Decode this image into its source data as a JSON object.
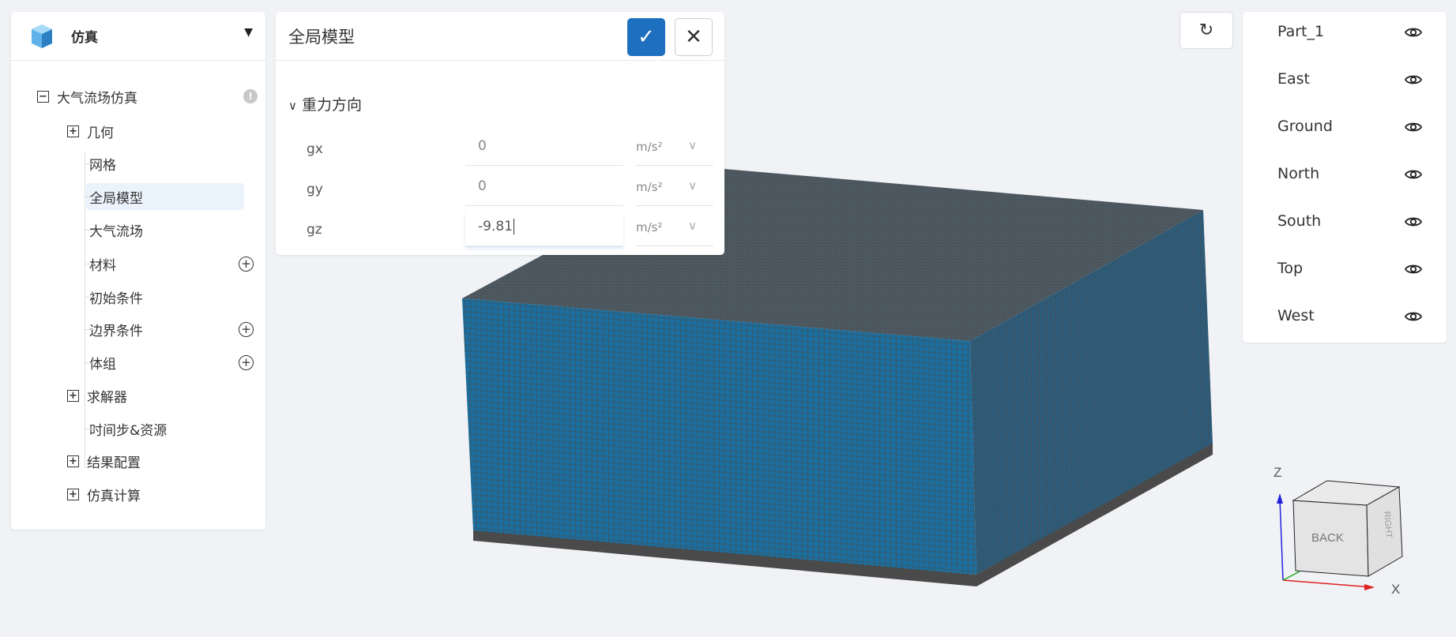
{
  "sidebar": {
    "title": "仿真",
    "tree": [
      {
        "label": "大气流场仿真",
        "level": 1,
        "expander": "minus",
        "badge": "warning"
      },
      {
        "label": "几何",
        "level": 2,
        "expander": "plus"
      },
      {
        "label": "网格",
        "level": 3
      },
      {
        "label": "全局模型",
        "level": 3,
        "selected": true
      },
      {
        "label": "大气流场",
        "level": 3
      },
      {
        "label": "材料",
        "level": 3,
        "add": true
      },
      {
        "label": "初始条件",
        "level": 3
      },
      {
        "label": "边界条件",
        "level": 3,
        "add": true
      },
      {
        "label": "体组",
        "level": 3,
        "add": true
      },
      {
        "label": "求解器",
        "level": 2,
        "expander": "plus"
      },
      {
        "label": "时间步&资源",
        "level": 3
      },
      {
        "label": "结果配置",
        "level": 2,
        "expander": "plus"
      },
      {
        "label": "仿真计算",
        "level": 2,
        "expander": "plus"
      }
    ]
  },
  "panel": {
    "title": "全局模型",
    "section": "重力方向",
    "fields": [
      {
        "label": "gx",
        "value": "0",
        "unit": "m/s²"
      },
      {
        "label": "gy",
        "value": "0",
        "unit": "m/s²"
      },
      {
        "label": "gz",
        "value": "-9.81",
        "unit": "m/s²",
        "active": true
      }
    ]
  },
  "parts": [
    "Part_1",
    "East",
    "Ground",
    "North",
    "South",
    "Top",
    "West"
  ],
  "axes": {
    "z": "Z",
    "x": "X",
    "cube_face": "BACK",
    "cube_right": "RIGHT"
  },
  "colors": {
    "accent": "#1e6fbf",
    "mesh": "#1b6e9e",
    "mesh_lines": "#4a4a4a"
  }
}
